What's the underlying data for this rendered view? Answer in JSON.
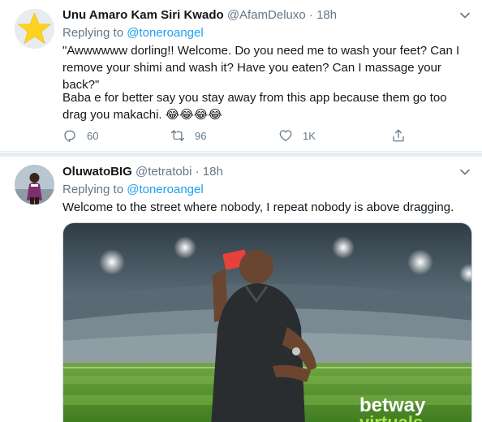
{
  "tweets": [
    {
      "author_name": "Unu Amaro Kam Siri Kwado",
      "handle": "@AfamDeluxo",
      "dot": "·",
      "time": "18h",
      "replying_prefix": "Replying to",
      "replying_to": "@toneroangel",
      "paragraph1": "\"Awwwwww dorling!! Welcome. Do you need me to wash your feet? Can I remove your shimi and wash it? Have you eaten? Can I massage your back?\"",
      "paragraph2": "Baba e for better say you stay away from this app because them go too drag you makachi. 😂😂😂😂",
      "counts": {
        "replies": "60",
        "retweets": "96",
        "likes": "1K"
      },
      "avatar_icon": "star-icon"
    },
    {
      "author_name": "OluwatoBIG",
      "handle": "@tetratobi",
      "dot": "·",
      "time": "18h",
      "replying_prefix": "Replying to",
      "replying_to": "@toneroangel",
      "paragraph1": "Welcome to the street where nobody, I repeat nobody is above dragging.",
      "media_watermark": "betway",
      "media_watermark2": "virtuals"
    }
  ],
  "colors": {
    "accent": "#1da1f2",
    "muted": "#657786",
    "text": "#14171a",
    "star": "#ffd21f",
    "star_bg": "#e6ecf0",
    "pitch_green": "#4e8a2a",
    "card_red": "#e8413c"
  }
}
